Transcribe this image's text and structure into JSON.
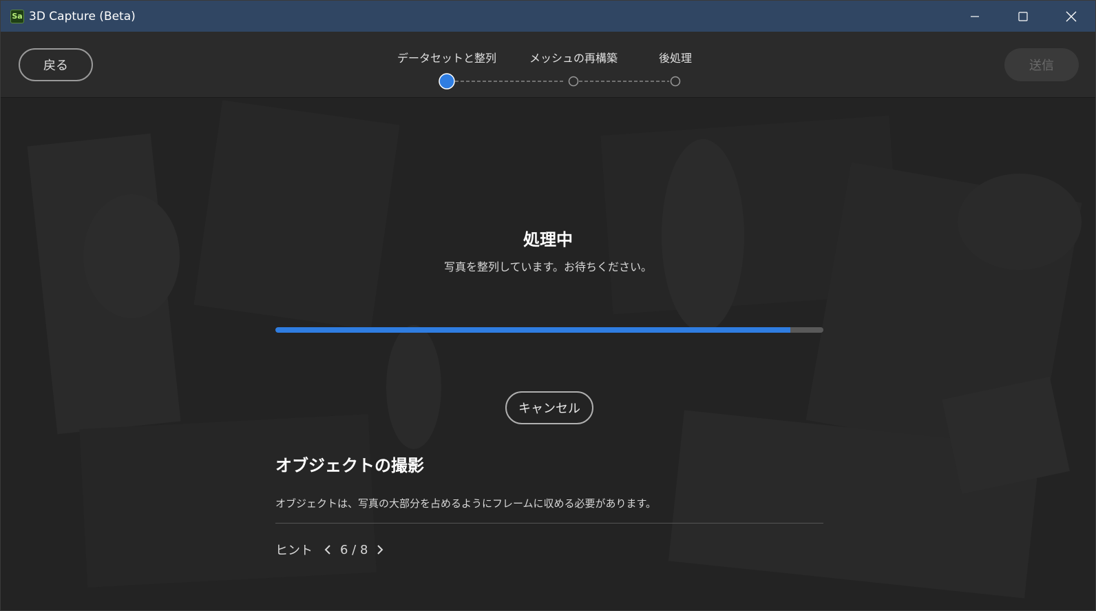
{
  "window": {
    "app_logo": "Sa",
    "title": "3D Capture (Beta)",
    "icons": {
      "minimize": "minimize-icon",
      "maximize": "maximize-icon",
      "close": "close-icon"
    }
  },
  "header": {
    "back_label": "戻る",
    "send_label": "送信",
    "steps": [
      {
        "label": "データセットと整列",
        "state": "active"
      },
      {
        "label": "メッシュの再構築",
        "state": "pending"
      },
      {
        "label": "後処理",
        "state": "pending"
      }
    ]
  },
  "main": {
    "title": "処理中",
    "subtitle": "写真を整列しています。お待ちください。",
    "progress": 0.94,
    "cancel_label": "キャンセル",
    "tip": {
      "title": "オブジェクトの撮影",
      "body": "オブジェクトは、写真の大部分を占めるようにフレームに収める必要があります。"
    },
    "hint": {
      "label": "ヒント",
      "count": "6 / 8"
    }
  },
  "colors": {
    "titlebar": "#304663",
    "accent": "#2f7de1",
    "header_bg": "#2b2b2b",
    "main_bg": "#222222"
  }
}
